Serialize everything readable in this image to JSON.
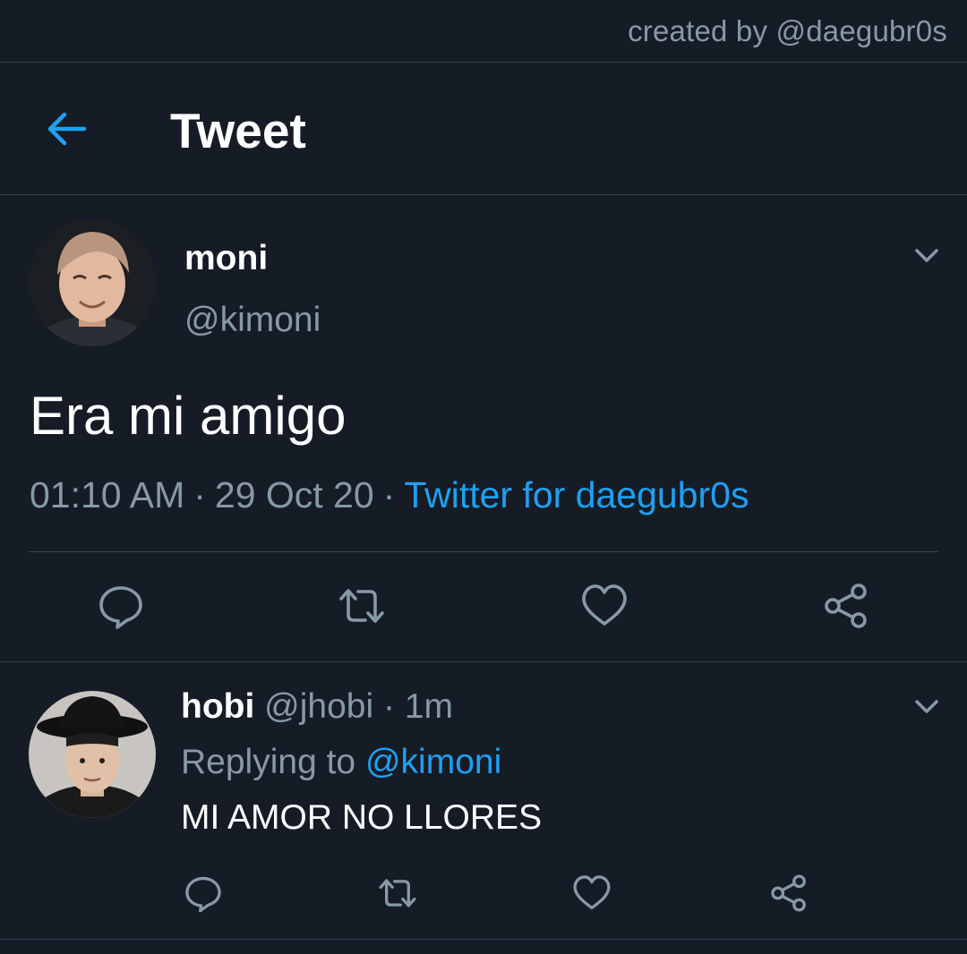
{
  "credit": "created by @daegubr0s",
  "header": {
    "title": "Tweet",
    "back_icon": "arrow-left-icon"
  },
  "colors": {
    "background": "#151c26",
    "accent": "#1da1f2",
    "muted": "#8899a6",
    "divider": "#38444d"
  },
  "main_tweet": {
    "name": "moni",
    "handle": "@kimoni",
    "text": "Era mi amigo",
    "time": "01:10 AM",
    "separator": "·",
    "date": "29 Oct 20",
    "source": "Twitter for daegubr0s",
    "actions": [
      "reply-icon",
      "retweet-icon",
      "like-icon",
      "share-icon"
    ]
  },
  "reply": {
    "name": "hobi",
    "handle": "@jhobi",
    "separator": "·",
    "time": "1m",
    "replying_prefix": "Replying to",
    "replying_to": "@kimoni",
    "text": "MI AMOR NO LLORES",
    "actions": [
      "reply-icon",
      "retweet-icon",
      "like-icon",
      "share-icon"
    ]
  }
}
